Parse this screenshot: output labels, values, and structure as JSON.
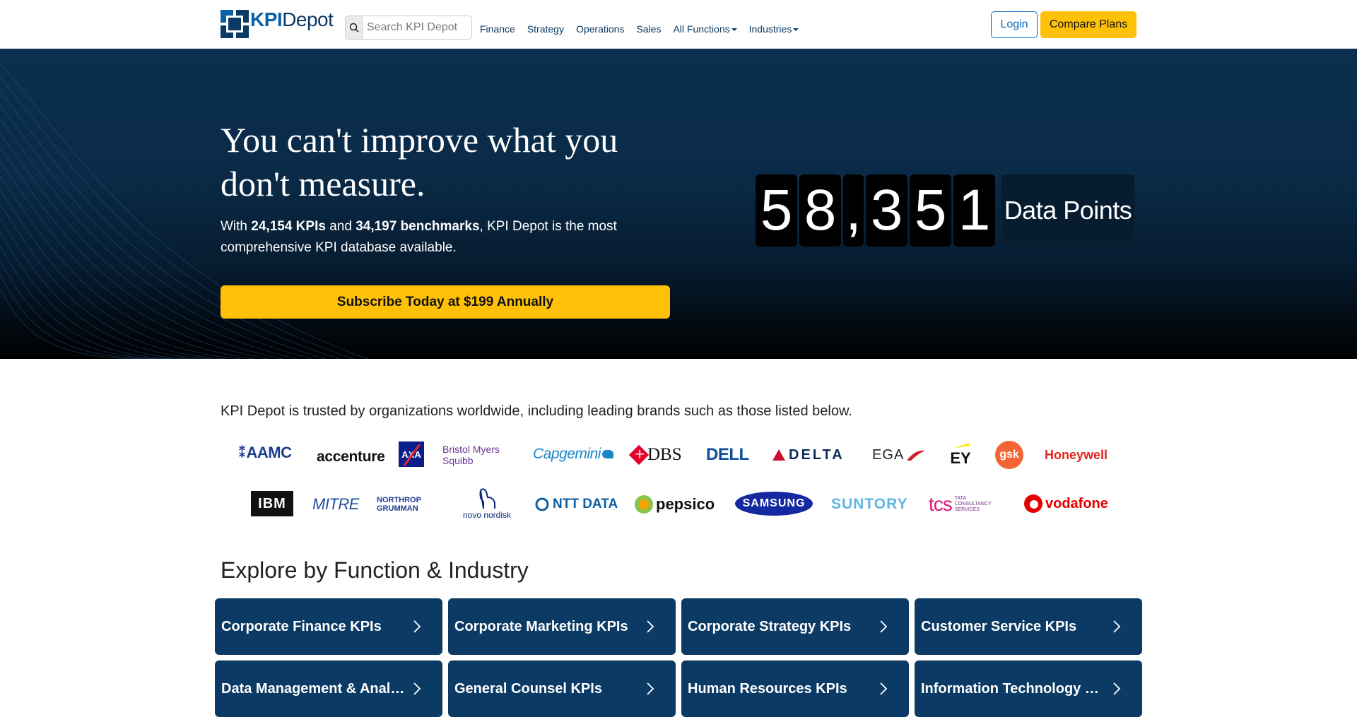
{
  "nav": {
    "logo_bold": "KPI",
    "logo_rest": "Depot",
    "search_placeholder": "Search KPI Depot",
    "links": [
      "Finance",
      "Strategy",
      "Operations",
      "Sales",
      "All Functions",
      "Industries"
    ],
    "login": "Login",
    "compare": "Compare Plans"
  },
  "hero": {
    "title": "You can't improve what you don't measure.",
    "sub_prefix": "With ",
    "kpis": "24,154 KPIs",
    "sub_and": " and ",
    "benchmarks": "34,197 benchmarks",
    "sub_suffix": ", KPI Depot is the most comprehensive KPI database available.",
    "cta": "Subscribe Today at $199 Annually",
    "counter_digits": [
      "5",
      "8",
      ",",
      "3",
      "5",
      "1"
    ],
    "counter_label": "Data Points"
  },
  "trusted": {
    "text": "KPI Depot is trusted by organizations worldwide, including leading brands such as those listed below.",
    "row1": [
      "AAMC",
      "accenture",
      "AXA",
      "Bristol Myers Squibb",
      "Capgemini",
      "DBS",
      "DELL",
      "DELTA",
      "EGA",
      "EY",
      "gsk",
      "Honeywell"
    ],
    "row2": [
      "IBM",
      "MITRE",
      "NORTHROP GRUMMAN",
      "novo nordisk",
      "NTT DATA",
      "pepsico",
      "SAMSUNG",
      "SUNTORY",
      "tcs",
      "TATA CONSULTANCY SERVICES",
      "vodafone"
    ]
  },
  "explore": {
    "title": "Explore by Function & Industry",
    "cards": [
      "Corporate Finance KPIs",
      "Corporate Marketing KPIs",
      "Corporate Strategy KPIs",
      "Customer Service KPIs",
      "Data Management & Analytics KPIs",
      "General Counsel KPIs",
      "Human Resources KPIs",
      "Information Technology KPIs"
    ]
  },
  "colors": {
    "navy": "#0b3a64",
    "accent_yellow": "#ffc107",
    "link_blue": "#0b6bbd"
  }
}
